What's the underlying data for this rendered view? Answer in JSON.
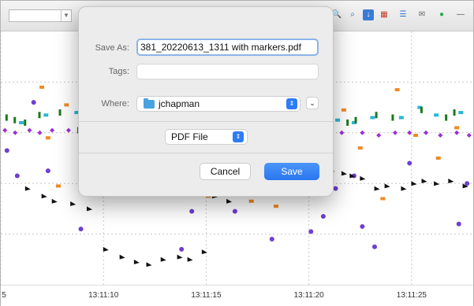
{
  "toolbar": {
    "icons": [
      "zoom-icon",
      "search-icon",
      "export-icon",
      "chart-icon",
      "list-icon",
      "mail-icon",
      "pin-icon"
    ]
  },
  "chart_data": {
    "type": "scatter",
    "x_tick_labels": [
      "5",
      "13:11:10",
      "13:11:15",
      "13:11:20",
      "13:11:25"
    ],
    "x_ticks_seconds": [
      5,
      10,
      15,
      20,
      25
    ],
    "xlim": [
      5,
      28
    ],
    "ylim": [
      0,
      100
    ],
    "grid": true,
    "series": [
      {
        "color": "#f08a24",
        "marker": "square",
        "points": [
          [
            7,
            78
          ],
          [
            7.3,
            58
          ],
          [
            7.8,
            39
          ],
          [
            8.2,
            71
          ],
          [
            9.4,
            61
          ],
          [
            10.6,
            36
          ],
          [
            12.1,
            59
          ],
          [
            15.1,
            35
          ],
          [
            17.2,
            33
          ],
          [
            18.4,
            31
          ],
          [
            19.3,
            83
          ],
          [
            20.6,
            76
          ],
          [
            21.7,
            69
          ],
          [
            22.5,
            54
          ],
          [
            23.6,
            34
          ],
          [
            24.3,
            77
          ],
          [
            25.2,
            59
          ],
          [
            26.3,
            50
          ],
          [
            27.2,
            62
          ]
        ]
      },
      {
        "color": "#2ab7d6",
        "marker": "square",
        "points": [
          [
            6,
            64
          ],
          [
            7.2,
            67
          ],
          [
            8.7,
            68
          ],
          [
            9.5,
            64
          ],
          [
            20.8,
            63
          ],
          [
            21.4,
            65
          ],
          [
            22.2,
            64
          ],
          [
            23.1,
            66
          ],
          [
            24.5,
            66
          ],
          [
            25.4,
            70
          ],
          [
            26.2,
            67
          ],
          [
            27.4,
            68
          ]
        ]
      },
      {
        "color": "#1a7a1a",
        "marker": "bar",
        "points": [
          [
            5.3,
            66
          ],
          [
            5.7,
            65
          ],
          [
            6.2,
            64
          ],
          [
            6.9,
            67
          ],
          [
            7.9,
            68
          ],
          [
            8.8,
            61
          ],
          [
            20.9,
            62
          ],
          [
            21.9,
            64
          ],
          [
            22.3,
            65
          ],
          [
            23.3,
            67
          ],
          [
            24.1,
            66
          ],
          [
            25.5,
            69
          ],
          [
            26.7,
            66
          ],
          [
            27.1,
            68
          ]
        ]
      },
      {
        "color": "#9b2fd6",
        "marker": "diamond",
        "points": [
          [
            5.2,
            61
          ],
          [
            5.7,
            60
          ],
          [
            6.4,
            61
          ],
          [
            6.9,
            60
          ],
          [
            7.5,
            61
          ],
          [
            8.3,
            61
          ],
          [
            9.2,
            60
          ],
          [
            20.9,
            60
          ],
          [
            21.6,
            60
          ],
          [
            22.6,
            60
          ],
          [
            23.4,
            59
          ],
          [
            24.2,
            60
          ],
          [
            24.9,
            60
          ],
          [
            25.7,
            60
          ],
          [
            26.4,
            59
          ],
          [
            27.2,
            60
          ],
          [
            27.8,
            59
          ]
        ]
      },
      {
        "color": "#6e3fd1",
        "marker": "circle",
        "points": [
          [
            5.3,
            53
          ],
          [
            5.8,
            43
          ],
          [
            6.6,
            72
          ],
          [
            7.3,
            45
          ],
          [
            8.9,
            22
          ],
          [
            10.2,
            45
          ],
          [
            12.5,
            44
          ],
          [
            13.8,
            14
          ],
          [
            14.3,
            29
          ],
          [
            14.8,
            37
          ],
          [
            16.4,
            29
          ],
          [
            17.2,
            45
          ],
          [
            18.2,
            18
          ],
          [
            20.1,
            21
          ],
          [
            20.7,
            27
          ],
          [
            21.3,
            38
          ],
          [
            22.2,
            43
          ],
          [
            22.6,
            23
          ],
          [
            23.2,
            15
          ],
          [
            24.9,
            48
          ],
          [
            27.3,
            24
          ],
          [
            27.7,
            40
          ]
        ]
      },
      {
        "color": "#111111",
        "marker": "triangle",
        "points": [
          [
            6.3,
            38
          ],
          [
            7.1,
            35
          ],
          [
            7.6,
            33
          ],
          [
            8.5,
            32
          ],
          [
            9.3,
            30
          ],
          [
            10.1,
            14
          ],
          [
            10.9,
            11
          ],
          [
            11.6,
            9
          ],
          [
            12.2,
            8
          ],
          [
            12.9,
            10
          ],
          [
            13.7,
            11
          ],
          [
            14.2,
            10
          ],
          [
            14.9,
            13
          ],
          [
            15.4,
            35
          ],
          [
            16.1,
            33
          ],
          [
            17.5,
            40
          ],
          [
            18.6,
            43
          ],
          [
            20.5,
            46
          ],
          [
            21.1,
            45
          ],
          [
            21.7,
            44
          ],
          [
            22.1,
            43
          ],
          [
            22.6,
            42
          ],
          [
            23.3,
            38
          ],
          [
            23.8,
            39
          ],
          [
            24.6,
            38
          ],
          [
            25.1,
            40
          ],
          [
            25.6,
            41
          ],
          [
            26.2,
            40
          ],
          [
            26.9,
            41
          ],
          [
            27.6,
            39
          ]
        ]
      }
    ]
  },
  "dialog": {
    "save_as_label": "Save As:",
    "save_as_value": "381_20220613_1311 with markers.pdf",
    "tags_label": "Tags:",
    "tags_value": "",
    "where_label": "Where:",
    "where_value": "jchapman",
    "format_value": "PDF File",
    "cancel_label": "Cancel",
    "save_label": "Save",
    "accent_color": "#2d7cf6"
  }
}
